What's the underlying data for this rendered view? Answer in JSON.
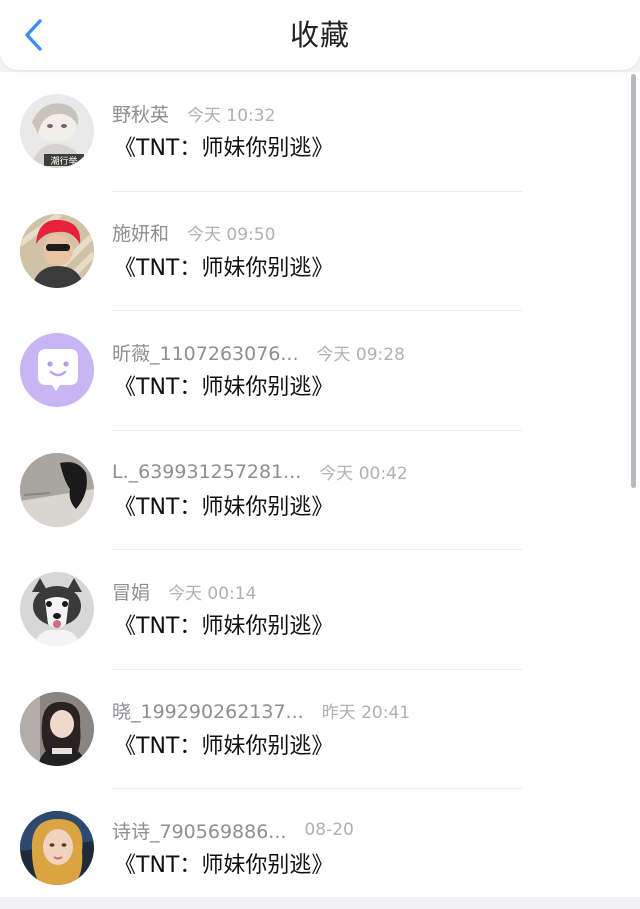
{
  "header": {
    "title": "收藏",
    "back_icon": "chevron-left-icon",
    "accent_color": "#3e8cf7"
  },
  "items": [
    {
      "name": "野秋英",
      "time": "今天 10:32",
      "message": "《TNT：师妹你别逃》",
      "avatar_badge": "潮行举"
    },
    {
      "name": "施妍和",
      "time": "今天 09:50",
      "message": "《TNT：师妹你别逃》"
    },
    {
      "name": "昕薇_1107263076...",
      "time": "今天 09:28",
      "message": "《TNT：师妹你别逃》"
    },
    {
      "name": "L._639931257281...",
      "time": "今天 00:42",
      "message": "《TNT：师妹你别逃》"
    },
    {
      "name": "冒娟",
      "time": "今天 00:14",
      "message": "《TNT：师妹你别逃》"
    },
    {
      "name": "晓_199290262137...",
      "time": "昨天 20:41",
      "message": "《TNT：师妹你别逃》"
    },
    {
      "name": "诗诗_790569886...",
      "time": "08-20",
      "message": "《TNT：师妹你别逃》"
    }
  ]
}
